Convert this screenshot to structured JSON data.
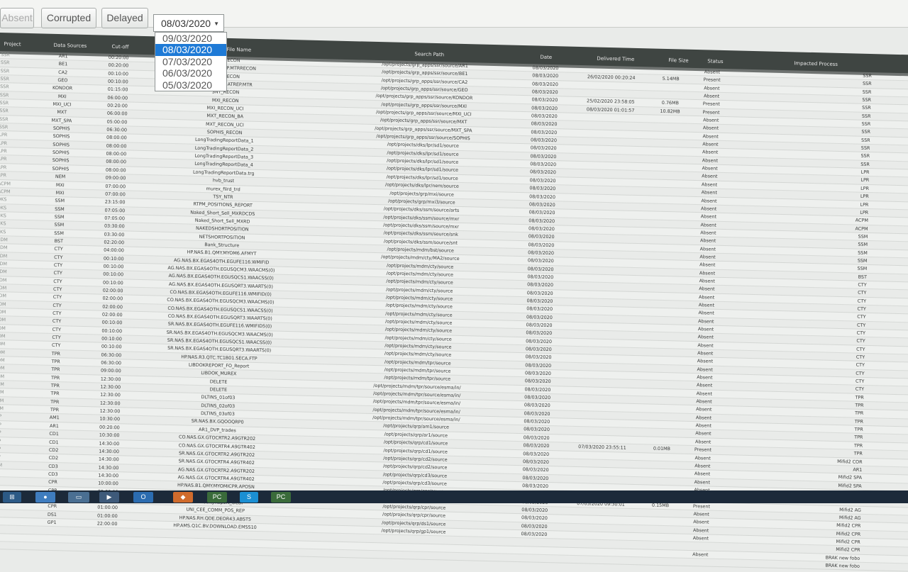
{
  "toolbar": {
    "absent_label": "Absent",
    "corrupted_label": "Corrupted",
    "delayed_label": "Delayed",
    "date_selected": "08/03/2020",
    "date_options": [
      "09/03/2020",
      "08/03/2020",
      "07/03/2020",
      "06/03/2020",
      "05/03/2020"
    ]
  },
  "table": {
    "headers": {
      "project": "Project",
      "data_sources": "Data Sources",
      "cutoff": "Cut-off",
      "file_name": "File Name",
      "search_path": "Search Path",
      "date": "Date",
      "delivered_time": "Delivered Time",
      "file_size": "File Size",
      "status": "Status",
      "impacted_process": "Impacted Process"
    },
    "rows": [
      [
        "SSR",
        "AR1",
        "00:20:00",
        "AR1_RECON",
        "/opt/projects/grp_apps/ssr/source/AR1",
        "08/03/2020",
        "",
        "",
        "Absent",
        "SSR"
      ],
      [
        "SSR",
        "BE1",
        "00:20:00",
        "BC_OBC040HP.MTRRECON",
        "/opt/projects/grp_apps/ssr/source/BE1",
        "08/03/2020",
        "26/02/2020 00:20:24",
        "5.14MB",
        "Present",
        "SSR"
      ],
      [
        "SSR",
        "CA2",
        "00:10:00",
        "CA2_RECON",
        "/opt/projects/grp_apps/ssr/source/CA2",
        "08/03/2020",
        "",
        "",
        "Absent",
        "SSR"
      ],
      [
        "SSR",
        "GEO",
        "00:10:00",
        "ZAE.MTRDR.ATREP.MTR",
        "/opt/projects/grp_apps/ssr/source/GEO",
        "08/03/2020",
        "",
        "",
        "Absent",
        "SSR"
      ],
      [
        "SSR",
        "KONDOR",
        "01:15:00",
        "SNT_RECON",
        "/opt/projects/grp_apps/ssr/source/KONDOR",
        "08/03/2020",
        "25/02/2020 23:58:05",
        "0.76MB",
        "Present",
        "SSR"
      ],
      [
        "SSR",
        "MXI",
        "06:00:00",
        "MXI_RECON",
        "/opt/projects/grp_apps/ssr/source/MXI",
        "08/03/2020",
        "08/03/2020 01:01:57",
        "10.82MB",
        "Present",
        "SSR"
      ],
      [
        "SSR",
        "MXI_UCI",
        "00:20:00",
        "MXI_RECON_UCI",
        "/opt/projects/grp_apps/ssr/source/MXI_UCI",
        "08/03/2020",
        "",
        "",
        "Absent",
        "SSR"
      ],
      [
        "SSR",
        "MXT",
        "06:00:00",
        "MXT_RECON_BA",
        "/opt/projects/grp_apps/ssr/source/MXT",
        "08/03/2020",
        "",
        "",
        "Absent",
        "SSR"
      ],
      [
        "SSR",
        "MXT_SPA",
        "05:00:00",
        "MXT_RECON_UCI",
        "/opt/projects/grp_apps/ssr/source/MXT_SPA",
        "08/03/2020",
        "",
        "",
        "Absent",
        "SSR"
      ],
      [
        "SSR",
        "SOPHIS",
        "06:30:00",
        "SOPHIS_RECON",
        "/opt/projects/grp_apps/ssr/source/SOPHIS",
        "08/03/2020",
        "",
        "",
        "Absent",
        "SSR"
      ],
      [
        "LPR",
        "SOPHIS",
        "08:00:00",
        "LongTradingReportData_1",
        "/opt/projects/dks/lpr/sd1/source",
        "08/03/2020",
        "",
        "",
        "Absent",
        "SSR"
      ],
      [
        "LPR",
        "SOPHIS",
        "08:00:00",
        "LongTradingReportData_2",
        "/opt/projects/dks/lpr/sd1/source",
        "08/03/2020",
        "",
        "",
        "Absent",
        "SSR"
      ],
      [
        "LPR",
        "SOPHIS",
        "08:00:00",
        "LongTradingReportData_3",
        "/opt/projects/dks/lpr/sd1/source",
        "08/03/2020",
        "",
        "",
        "Absent",
        "LPR"
      ],
      [
        "LPR",
        "SOPHIS",
        "08:00:00",
        "LongTradingReportData_4",
        "/opt/projects/dks/lpr/sd1/source",
        "08/03/2020",
        "",
        "",
        "Absent",
        "LPR"
      ],
      [
        "LPR",
        "SOPHIS",
        "08:00:00",
        "LongTradingReportData.trg",
        "/opt/projects/dks/lpr/sd1/source",
        "08/03/2020",
        "",
        "",
        "Absent",
        "LPR"
      ],
      [
        "LPR",
        "NEM",
        "09:00:00",
        "hvb_trust",
        "/opt/projects/dks/lpr/nem/source",
        "08/03/2020",
        "",
        "",
        "Absent",
        "LPR"
      ],
      [
        "ACPM",
        "MXI",
        "07:00:00",
        "murex_fiird_trd",
        "/opt/projects/grp/mxi/source",
        "08/03/2020",
        "",
        "",
        "Absent",
        "LPR"
      ],
      [
        "ACPM",
        "MXI",
        "07:00:00",
        "TSY_NTR",
        "/opt/projects/grp/mxi3/source",
        "08/03/2020",
        "",
        "",
        "Absent",
        "LPR"
      ],
      [
        "DKS",
        "SSM",
        "23:15:00",
        "RTPM_POSITIONS_REPORT",
        "/opt/projects/dks/ssm/source/arts",
        "08/03/2020",
        "",
        "",
        "Absent",
        "ACPM"
      ],
      [
        "DKS",
        "SSM",
        "07:05:00",
        "Naked_Short_Sell_MXRDCDS",
        "/opt/projects/dks/ssm/source/mxr",
        "08/03/2020",
        "",
        "",
        "Absent",
        "ACPM"
      ],
      [
        "DKS",
        "SSM",
        "07:05:00",
        "Naked_Short_Sell_MXRD",
        "/opt/projects/dks/ssm/source/mxr",
        "08/03/2020",
        "",
        "",
        "Absent",
        "SSM"
      ],
      [
        "DKS",
        "SSM",
        "03:30:00",
        "NAKEDSHORTPOSITION",
        "/opt/projects/dks/ssm/source/snk",
        "08/03/2020",
        "",
        "",
        "Absent",
        "SSM"
      ],
      [
        "DKS",
        "SSM",
        "03:30:00",
        "NETSHORTPOSITION",
        "/opt/projects/dks/ssm/source/snt",
        "08/03/2020",
        "",
        "",
        "Absent",
        "SSM"
      ],
      [
        "MDM",
        "BST",
        "02:20:00",
        "Bank_Structure",
        "/opt/projects/mdm/bst/source",
        "08/03/2020",
        "",
        "",
        "Absent",
        "SSM"
      ],
      [
        "MDM",
        "CTY",
        "04:00:00",
        "HP.NAS.B1.QMY.MYOM6.AFMYT",
        "/opt/projects/mdm/cty/MA2/source",
        "08/03/2020",
        "",
        "",
        "Absent",
        "SSM"
      ],
      [
        "MDM",
        "CTY",
        "00:10:00",
        "AG.NAS.BX.EGAS4OTH.EGUFE116.WMIFID",
        "/opt/projects/mdm/cty/source",
        "08/03/2020",
        "",
        "",
        "Absent",
        "BST"
      ],
      [
        "MDM",
        "CTY",
        "00:10:00",
        "AG.NAS.BX.EGAS4OTH.EGUSQCM3.WAACMS(0)",
        "/opt/projects/mdm/cty/source",
        "08/03/2020",
        "",
        "",
        "Absent",
        "CTY"
      ],
      [
        "MDM",
        "CTY",
        "00:10:00",
        "AG.NAS.BX.EGAS4OTH.EGUSQCS1.WAACSS(0)",
        "/opt/projects/mdm/cty/source",
        "08/03/2020",
        "",
        "",
        "Absent",
        "CTY"
      ],
      [
        "MDM",
        "CTY",
        "00:10:00",
        "AG.NAS.BX.EGAS4OTH.EGUSQRT3.WAARTS(0)",
        "/opt/projects/mdm/cty/source",
        "08/03/2020",
        "",
        "",
        "Absent",
        "CTY"
      ],
      [
        "MDM",
        "CTY",
        "02:00:00",
        "CO.NAS.BX.EGAS4OTH.EGUFE116.WMIFID(0)",
        "/opt/projects/mdm/cty/source",
        "08/03/2020",
        "",
        "",
        "Absent",
        "CTY"
      ],
      [
        "MDM",
        "CTY",
        "02:00:00",
        "CO.NAS.BX.EGAS4OTH.EGUSQCM3.WAACMS(0)",
        "/opt/projects/mdm/cty/source",
        "08/03/2020",
        "",
        "",
        "Absent",
        "CTY"
      ],
      [
        "MDM",
        "CTY",
        "02:00:00",
        "CO.NAS.BX.EGAS4OTH.EGUSQCS1.WAACSS(0)",
        "/opt/projects/mdm/cty/source",
        "08/03/2020",
        "",
        "",
        "Absent",
        "CTY"
      ],
      [
        "MDM",
        "CTY",
        "02:00:00",
        "CO.NAS.BX.EGAS4OTH.EGUSQRT3.WAARTS(0)",
        "/opt/projects/mdm/cty/source",
        "08/03/2020",
        "",
        "",
        "Absent",
        "CTY"
      ],
      [
        "MDM",
        "CTY",
        "00:10:00",
        "SR.NAS.BX.EGAS4OTH.EGUFE116.WMIFID5(0)",
        "/opt/projects/mdm/cty/source",
        "08/03/2020",
        "",
        "",
        "Absent",
        "CTY"
      ],
      [
        "MDM",
        "CTY",
        "00:10:00",
        "SR.NAS.BX.EGAS4OTH.EGUSQCM3.WAACMS(0)",
        "/opt/projects/mdm/cty/source",
        "08/03/2020",
        "",
        "",
        "Absent",
        "CTY"
      ],
      [
        "MDM",
        "CTY",
        "00:10:00",
        "SR.NAS.BX.EGAS4OTH.EGUSQCS1.WAACSS(0)",
        "/opt/projects/mdm/cty/source",
        "08/03/2020",
        "",
        "",
        "Absent",
        "CTY"
      ],
      [
        "MDM",
        "CTY",
        "00:10:00",
        "SR.NAS.BX.EGAS4OTH.EGUSQRT3.WAARTS(0)",
        "/opt/projects/mdm/cty/source",
        "08/03/2020",
        "",
        "",
        "Absent",
        "CTY"
      ],
      [
        "MDM",
        "TPR",
        "06:30:00",
        "HP.NAS.R3.QTC.TC1B01.SECA.FTP",
        "/opt/projects/mdm/tpr/source",
        "08/03/2020",
        "",
        "",
        "Absent",
        "CTY"
      ],
      [
        "MDM",
        "TPR",
        "06:30:00",
        "LIBDOKREPORT_FO_Report",
        "/opt/projects/mdm/tpr/source",
        "08/03/2020",
        "",
        "",
        "Absent",
        "CTY"
      ],
      [
        "MDM",
        "TPR",
        "09:00:00",
        "LIBDOK_MUREX",
        "/opt/projects/mdm/tpr/source",
        "08/03/2020",
        "",
        "",
        "Absent",
        "CTY"
      ],
      [
        "MDM",
        "TPR",
        "12:30:00",
        "DELETE",
        "/opt/projects/mdm/tpr/source/esma/in/",
        "08/03/2020",
        "",
        "",
        "Absent",
        "TPR"
      ],
      [
        "MDM",
        "TPR",
        "12:30:00",
        "DELETE",
        "/opt/projects/mdm/tpr/source/esma/in/",
        "08/03/2020",
        "",
        "",
        "Absent",
        "TPR"
      ],
      [
        "MDM",
        "TPR",
        "12:30:00",
        "DLTINS_01of03",
        "/opt/projects/mdm/tpr/source/esma/in/",
        "08/03/2020",
        "",
        "",
        "Absent",
        "TPR"
      ],
      [
        "MDM",
        "TPR",
        "12:30:00",
        "DLTINS_02of03",
        "/opt/projects/mdm/tpr/source/esma/in/",
        "08/03/2020",
        "",
        "",
        "Absent",
        "TPR"
      ],
      [
        "MDM",
        "TPR",
        "12:30:00",
        "DLTINS_03of03",
        "/opt/projects/mdm/tpr/source/esma/in/",
        "08/03/2020",
        "",
        "",
        "Absent",
        "TPR"
      ],
      [
        "QRP",
        "AM1",
        "10:30:00",
        "SR.NAS.BX.GQOOQRP0",
        "/opt/projects/qrp/am1/source",
        "08/03/2020",
        "",
        "",
        "Absent",
        "TPR"
      ],
      [
        "QRP",
        "AR1",
        "00:20:00",
        "AR1_DVP_trades",
        "/opt/projects/qrp/ar1/source",
        "08/03/2020",
        "",
        "",
        "Absent",
        "TPR"
      ],
      [
        "QRP",
        "CD1",
        "10:30:00",
        "CO.NAS.GX.GTOCRTR2.A9GTR202",
        "/opt/projects/qrp/cd1/source",
        "08/03/2020",
        "07/03/2020 23:55:11",
        "0.01MB",
        "Present",
        "TPR"
      ],
      [
        "QRP",
        "CD1",
        "14:30:00",
        "CO.NAS.GX.GTOCRTR4.A9GTR402",
        "/opt/projects/qrp/cd1/source",
        "08/03/2020",
        "",
        "",
        "Absent",
        "Mifid2 COR"
      ],
      [
        "QRP",
        "CD2",
        "14:30:00",
        "SR.NAS.GX.GTOCRTR2.A9GTR202",
        "/opt/projects/qrp/cd2/source",
        "08/03/2020",
        "",
        "",
        "Absent",
        "AR1"
      ],
      [
        "QRP",
        "CD2",
        "14:30:00",
        "SR.NAS.GX.GTOCRTR4.A9GTR402",
        "/opt/projects/qrp/cd2/source",
        "08/03/2020",
        "",
        "",
        "Absent",
        "Mifid2 SPA"
      ],
      [
        "MDM",
        "CD3",
        "14:30:00",
        "AG.NAS.GX.GTOCRTR2.A9GTR202",
        "/opt/projects/qrp/cd3/source",
        "08/03/2020",
        "",
        "",
        "Absent",
        "Mifid2 SPA"
      ],
      [
        "QRP",
        "CD3",
        "14:30:00",
        "AG.NAS.GX.GTOCRTR4.A9GTR402",
        "/opt/projects/qrp/cd3/source",
        "08/03/2020",
        "",
        "",
        "Absent",
        "Mifid2 COR"
      ],
      [
        "QRP",
        "CPR",
        "10:00:00",
        "HP.NAS.B1.QMY.MYOMICPR.APOSN",
        "/opt/projects/qrp/cpr/source",
        "08/03/2020",
        "",
        "",
        "Absent",
        ""
      ],
      [
        "QRP",
        "CPR",
        "05:00:00",
        "Commodity/Report_HVB",
        "/opt/projects/qrp/cpr/source",
        "08/03/2020",
        "07/03/2020 09:30:01",
        "0.15MB",
        "Present",
        "Mifid2 AG"
      ],
      [
        "QRP",
        "CPR",
        "05:00:00",
        "CommodityReport_UCBI",
        "/opt/projects/qrp/cpr/source",
        "08/03/2020",
        "",
        "",
        "Absent",
        "Mifid2 AG"
      ],
      [
        "QRP",
        "CPR",
        "01:00:00",
        "UNI_CEE_COMM_POS_REP",
        "/opt/projects/qrp/cpr/source",
        "08/03/2020",
        "",
        "",
        "Absent",
        "Mifid2 CPR"
      ],
      [
        "QRP",
        "DS1",
        "01:00:00",
        "HP.NAS.RH.QDE.DEOR43.ABST5",
        "/opt/projects/qrp/ds1/source",
        "08/03/2020",
        "",
        "",
        "Absent",
        "Mifid2 CPR"
      ],
      [
        "QRP",
        "GP1",
        "22:00:00",
        "HP.AMS.Q1C.BV.DOWNLOAD.EMSS10",
        "/opt/projects/qrp/gp1/source",
        "08/03/2020",
        "",
        "",
        "Absent",
        "Mifid2 CPR"
      ],
      [
        "",
        "",
        "",
        "",
        "",
        "",
        "",
        "",
        "",
        "Mifid2 CPR"
      ],
      [
        "",
        "",
        "",
        "",
        "",
        "",
        "",
        "",
        "Absent",
        "BRAK new fobo"
      ],
      [
        "",
        "",
        "",
        "",
        "",
        "",
        "",
        "",
        "",
        "BRAK new fobo"
      ]
    ]
  },
  "taskbar": {
    "items": [
      {
        "icon": "windows-start-icon",
        "label": ""
      },
      {
        "icon": "chrome-icon",
        "label": ""
      },
      {
        "icon": "explorer-icon",
        "label": ""
      },
      {
        "icon": "media-player-icon",
        "label": ""
      },
      {
        "icon": "outlook-icon",
        "label": ""
      },
      {
        "icon": "app-icon",
        "label": ""
      },
      {
        "icon": "chrome-icon",
        "label": ""
      },
      {
        "icon": "pycharm-icon",
        "label": "PC"
      },
      {
        "icon": "skype-icon",
        "label": "S"
      },
      {
        "icon": "pycharm-icon",
        "label": "PC"
      }
    ]
  },
  "colors": {
    "header_bg": "#3f4542",
    "selected_option": "#1e7ad6",
    "taskbar_bg": "#1c2a3a"
  }
}
